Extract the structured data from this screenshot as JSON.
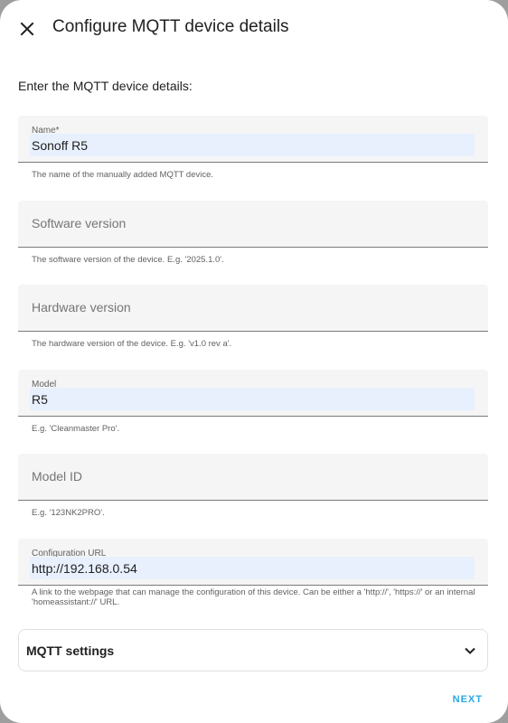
{
  "dialog": {
    "title": "Configure MQTT device details",
    "intro": "Enter the MQTT device details:"
  },
  "fields": {
    "name": {
      "label": "Name*",
      "value": "Sonoff R5",
      "helper": "The name of the manually added MQTT device."
    },
    "sw_version": {
      "label": "Software version",
      "value": "",
      "helper": "The software version of the device. E.g. '2025.1.0'."
    },
    "hw_version": {
      "label": "Hardware version",
      "value": "",
      "helper": "The hardware version of the device. E.g. 'v1.0 rev a'."
    },
    "model": {
      "label": "Model",
      "value": "R5",
      "helper": "E.g. 'Cleanmaster Pro'."
    },
    "model_id": {
      "label": "Model ID",
      "value": "",
      "helper": "E.g. '123NK2PRO'."
    },
    "configuration_url": {
      "label": "Configuration URL",
      "value": "http://192.168.0.54",
      "helper": "A link to the webpage that can manage the configuration of this device. Can be either a 'http://', 'https://' or an internal 'homeassistant://' URL."
    }
  },
  "mqtt_settings": {
    "label": "MQTT settings"
  },
  "actions": {
    "next_label": "NEXT"
  },
  "icons": {
    "close": "close-icon",
    "expand": "chevron-down-icon"
  },
  "colors": {
    "accent": "#29a8e0",
    "field_bg": "#f5f5f5",
    "autofill_bg": "#e8f0fe"
  }
}
